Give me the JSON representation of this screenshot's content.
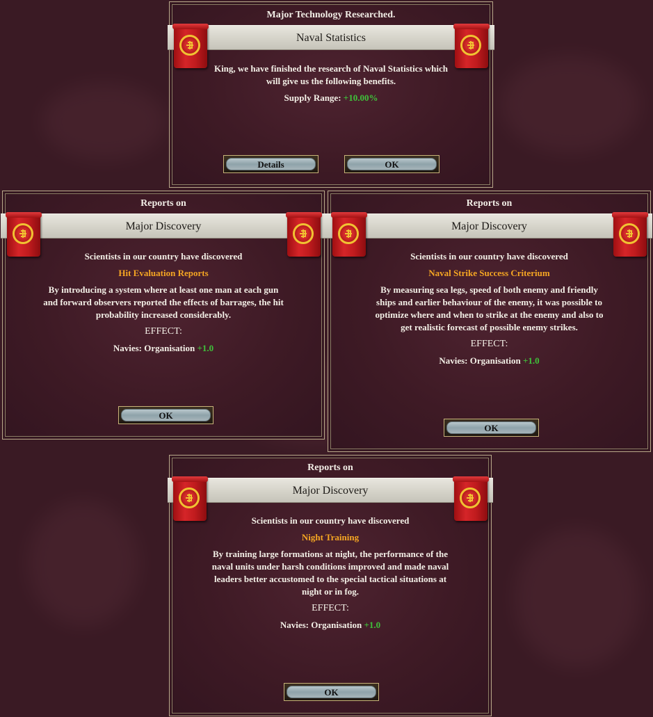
{
  "panel_top": {
    "header": "Major Technology Researched.",
    "title": "Naval Statistics",
    "body": "King, we have finished the research of Naval Statistics which will give us the following benefits.",
    "effect_label": "Supply Range:",
    "effect_value": "+10.00%",
    "details_button": "Details",
    "ok_button": "OK"
  },
  "panel_left": {
    "header": "Reports on",
    "title": "Major Discovery",
    "intro": "Scientists in our country have discovered",
    "discovery": "Hit Evaluation Reports",
    "body": "By introducing a system where at least one man at each gun and forward observers reported the effects of barrages, the hit probability increased considerably.",
    "effect_heading": "EFFECT:",
    "effect_label": "Navies: Organisation",
    "effect_value": "+1.0",
    "ok_button": "OK"
  },
  "panel_right": {
    "header": "Reports on",
    "title": "Major Discovery",
    "intro": "Scientists in our country have discovered",
    "discovery": "Naval Strike Success Criterium",
    "body": "By measuring sea legs, speed of both enemy and friendly ships and earlier behaviour of the enemy, it was possible to optimize where and when to strike at the enemy and also to get realistic forecast of possible enemy strikes.",
    "effect_heading": "EFFECT:",
    "effect_label": "Navies: Organisation",
    "effect_value": "+1.0",
    "ok_button": "OK"
  },
  "panel_bottom": {
    "header": "Reports on",
    "title": "Major Discovery",
    "intro": "Scientists in our country have discovered",
    "discovery": "Night Training",
    "body": "By training large formations at night, the performance of the naval units under harsh conditions improved and made naval leaders better accustomed to the special tactical situations at night or in fog.",
    "effect_heading": "EFFECT:",
    "effect_label": "Navies: Organisation",
    "effect_value": "+1.0",
    "ok_button": "OK"
  },
  "colors": {
    "background": "#3a1a24",
    "highlight": "#f5a623",
    "positive": "#3fc13a",
    "banner_red": "#c01b1e",
    "emblem_gold": "#f1c232"
  },
  "icons": [
    "national-banner-icon",
    "laurel-emblem-icon"
  ]
}
